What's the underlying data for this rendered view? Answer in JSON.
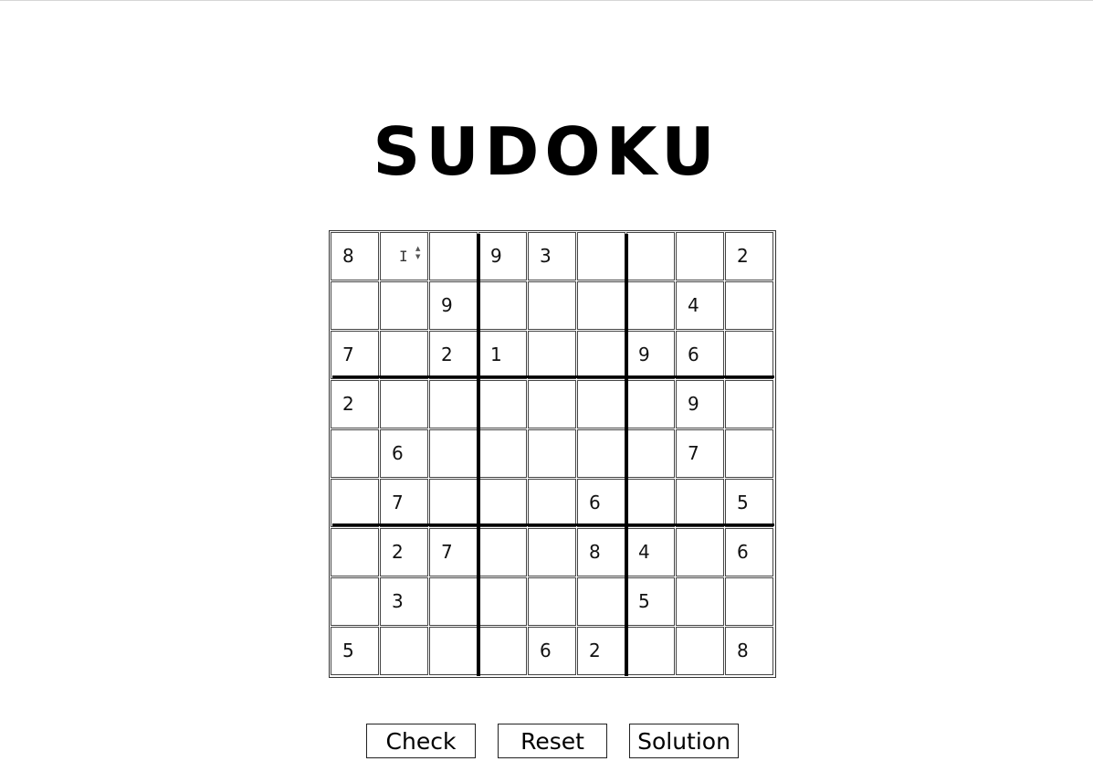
{
  "title": "SUDOKU",
  "grid": [
    [
      "8",
      "",
      "",
      "9",
      "3",
      "",
      "",
      "",
      "2"
    ],
    [
      "",
      "",
      "9",
      "",
      "",
      "",
      "",
      "4",
      ""
    ],
    [
      "7",
      "",
      "2",
      "1",
      "",
      "",
      "9",
      "6",
      ""
    ],
    [
      "2",
      "",
      "",
      "",
      "",
      "",
      "",
      "9",
      ""
    ],
    [
      "",
      "6",
      "",
      "",
      "",
      "",
      "",
      "7",
      ""
    ],
    [
      "",
      "7",
      "",
      "",
      "",
      "6",
      "",
      "",
      "5"
    ],
    [
      "",
      "2",
      "7",
      "",
      "",
      "8",
      "4",
      "",
      "6"
    ],
    [
      "",
      "3",
      "",
      "",
      "",
      "",
      "5",
      "",
      ""
    ],
    [
      "5",
      "",
      "",
      "",
      "6",
      "2",
      "",
      "",
      "8"
    ]
  ],
  "focused_cell": {
    "row": 0,
    "col": 1
  },
  "buttons": {
    "check": "Check",
    "reset": "Reset",
    "solution": "Solution"
  },
  "colors": {
    "background": "#ffffff",
    "grid_line": "#444444",
    "box_line": "#000000",
    "text": "#111111"
  }
}
